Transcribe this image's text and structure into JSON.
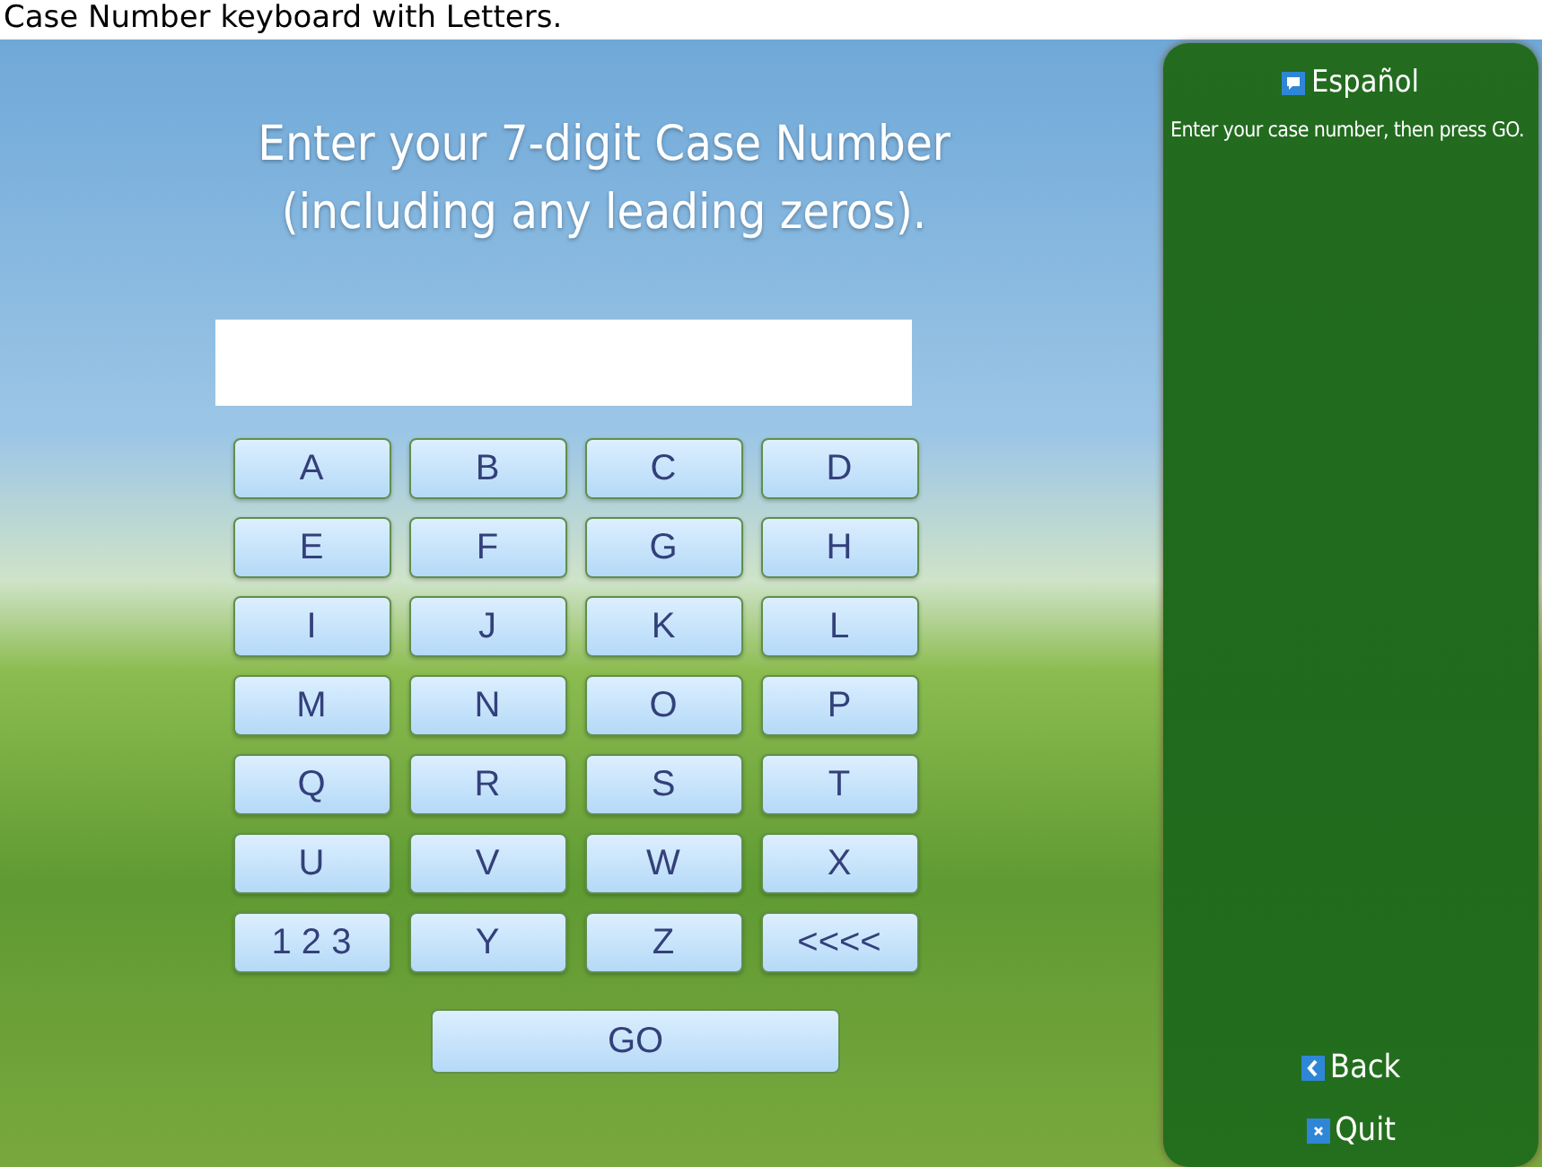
{
  "caption": "Case Number keyboard with Letters.",
  "prompt": {
    "line_1": "Enter your 7-digit Case Number",
    "line_2": "(including any leading zeros)."
  },
  "keys": [
    [
      "A",
      "B",
      "C",
      "D"
    ],
    [
      "E",
      "F",
      "G",
      "H"
    ],
    [
      "I",
      "J",
      "K",
      "L"
    ],
    [
      "M",
      "N",
      "O",
      "P"
    ],
    [
      "Q",
      "R",
      "S",
      "T"
    ],
    [
      "U",
      "V",
      "W",
      "X"
    ],
    [
      "1 2 3",
      "Y",
      "Z",
      "<<<<"
    ]
  ],
  "go_button": "GO",
  "side_panel": {
    "language_link": "Español",
    "instructions": "Enter your case number, then press GO.",
    "back_link": "Back",
    "quit_link": "Quit"
  }
}
